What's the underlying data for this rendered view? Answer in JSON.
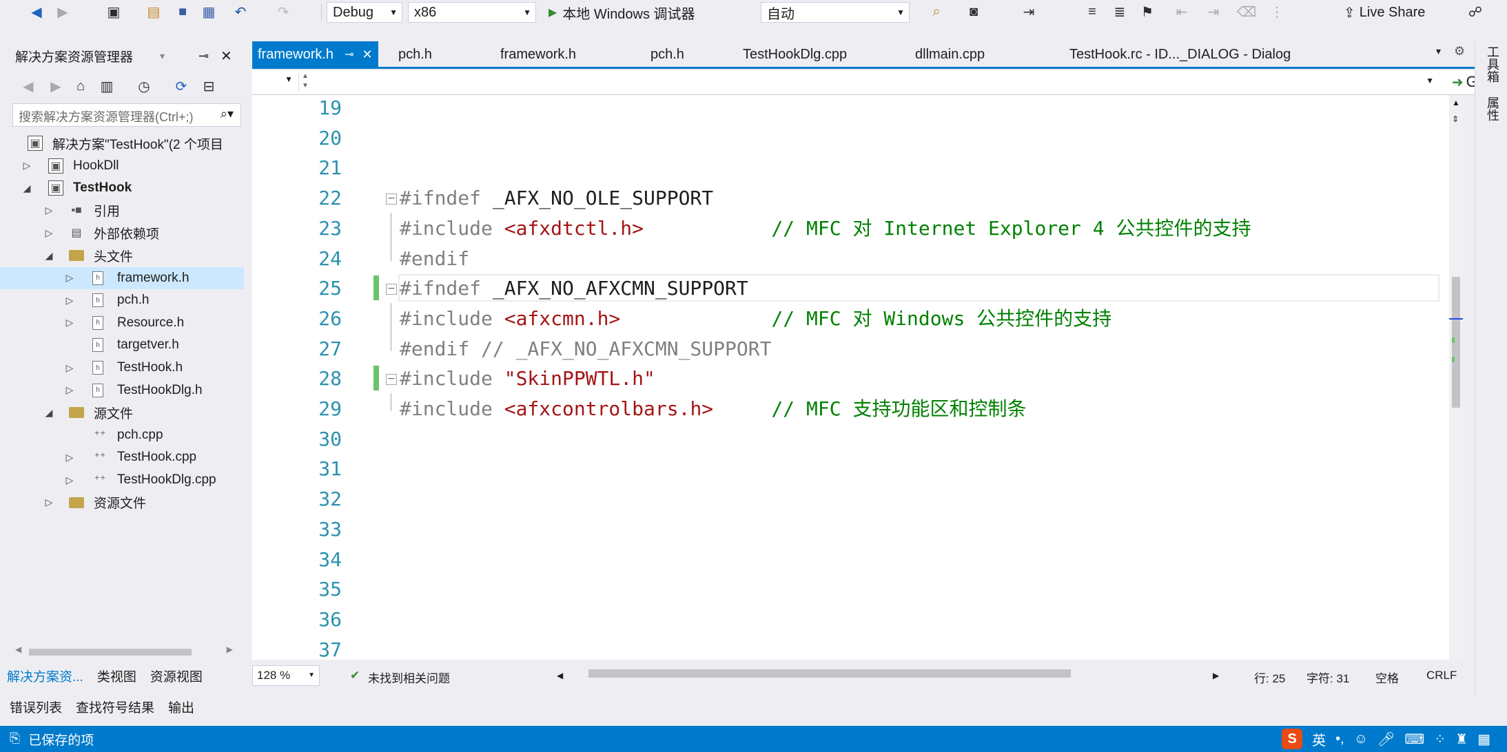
{
  "toolbar": {
    "config": "Debug",
    "platform": "x86",
    "run_label": "本地 Windows 调试器",
    "run_mode": "自动",
    "live_share": "Live Share"
  },
  "solution_explorer": {
    "title": "解决方案资源管理器",
    "search_placeholder": "搜索解决方案资源管理器(Ctrl+;)",
    "tree": [
      {
        "label": "解决方案\"TestHook\"(2 个项目",
        "depth": 0,
        "expander": "",
        "icon": "solution"
      },
      {
        "label": "HookDll",
        "depth": 0,
        "expander": "▷",
        "icon": "project"
      },
      {
        "label": "TestHook",
        "depth": 0,
        "expander": "◢",
        "icon": "project",
        "bold": true
      },
      {
        "label": "引用",
        "depth": 1,
        "expander": "▷",
        "icon": "references"
      },
      {
        "label": "外部依赖项",
        "depth": 1,
        "expander": "▷",
        "icon": "external"
      },
      {
        "label": "头文件",
        "depth": 1,
        "expander": "◢",
        "icon": "folder"
      },
      {
        "label": "framework.h",
        "depth": 2,
        "expander": "▷",
        "icon": "header",
        "selected": true
      },
      {
        "label": "pch.h",
        "depth": 2,
        "expander": "▷",
        "icon": "header"
      },
      {
        "label": "Resource.h",
        "depth": 2,
        "expander": "▷",
        "icon": "header"
      },
      {
        "label": "targetver.h",
        "depth": 2,
        "expander": "",
        "icon": "header"
      },
      {
        "label": "TestHook.h",
        "depth": 2,
        "expander": "▷",
        "icon": "header"
      },
      {
        "label": "TestHookDlg.h",
        "depth": 2,
        "expander": "▷",
        "icon": "header"
      },
      {
        "label": "源文件",
        "depth": 1,
        "expander": "◢",
        "icon": "folder"
      },
      {
        "label": "pch.cpp",
        "depth": 2,
        "expander": "",
        "icon": "cpp"
      },
      {
        "label": "TestHook.cpp",
        "depth": 2,
        "expander": "▷",
        "icon": "cpp"
      },
      {
        "label": "TestHookDlg.cpp",
        "depth": 2,
        "expander": "▷",
        "icon": "cpp"
      },
      {
        "label": "资源文件",
        "depth": 1,
        "expander": "▷",
        "icon": "folder"
      }
    ],
    "tabs": [
      "解决方案资...",
      "类视图",
      "资源视图"
    ],
    "active_tab": 0
  },
  "bottom_tabs": [
    "错误列表",
    "查找符号结果",
    "输出"
  ],
  "doc_tabs": [
    {
      "label": "framework.h",
      "active": true,
      "pin": "⊸",
      "close": "✕"
    },
    {
      "label": "pch.h"
    },
    {
      "label": "framework.h"
    },
    {
      "label": "pch.h"
    },
    {
      "label": "TestHookDlg.cpp"
    },
    {
      "label": "dllmain.cpp"
    },
    {
      "label": "TestHook.rc - ID..._DIALOG - Dialog"
    }
  ],
  "nav": {
    "go_label": "Go"
  },
  "editor": {
    "lines": [
      {
        "n": "19",
        "tokens": []
      },
      {
        "n": "20",
        "tokens": []
      },
      {
        "n": "21",
        "tokens": []
      },
      {
        "n": "22",
        "fold": "start",
        "tokens": [
          [
            "pp",
            "#ifndef "
          ],
          [
            "mac",
            "_AFX_NO_OLE_SUPPORT"
          ]
        ]
      },
      {
        "n": "23",
        "fold": "mid",
        "tokens": [
          [
            "pp",
            "#include "
          ],
          [
            "str",
            "<afxdtctl.h>"
          ],
          [
            "mac",
            "           "
          ],
          [
            "cmt",
            "// MFC 对 Internet Explorer 4 公共控件的支持"
          ]
        ]
      },
      {
        "n": "24",
        "fold": "end",
        "tokens": [
          [
            "pp",
            "#endif"
          ]
        ]
      },
      {
        "n": "25",
        "fold": "start",
        "changed": true,
        "current": true,
        "tokens": [
          [
            "pp",
            "#ifndef "
          ],
          [
            "mac",
            "_AFX_NO_AFXCMN_SUPPORT"
          ]
        ]
      },
      {
        "n": "26",
        "fold": "mid",
        "tokens": [
          [
            "pp",
            "#include "
          ],
          [
            "str",
            "<afxcmn.h>"
          ],
          [
            "mac",
            "             "
          ],
          [
            "cmt",
            "// MFC 对 Windows 公共控件的支持"
          ]
        ]
      },
      {
        "n": "27",
        "fold": "end",
        "tokens": [
          [
            "pp",
            "#endif // _AFX_NO_AFXCMN_SUPPORT"
          ]
        ]
      },
      {
        "n": "28",
        "fold": "start",
        "changed": true,
        "tokens": [
          [
            "pp",
            "#include "
          ],
          [
            "str",
            "\"SkinPPWTL.h\""
          ]
        ]
      },
      {
        "n": "29",
        "fold": "end",
        "tokens": [
          [
            "pp",
            "#include "
          ],
          [
            "str",
            "<afxcontrolbars.h>"
          ],
          [
            "mac",
            "     "
          ],
          [
            "cmt",
            "// MFC 支持功能区和控制条"
          ]
        ]
      },
      {
        "n": "30",
        "tokens": []
      },
      {
        "n": "31",
        "tokens": []
      },
      {
        "n": "32",
        "tokens": []
      },
      {
        "n": "33",
        "tokens": []
      },
      {
        "n": "34",
        "tokens": []
      },
      {
        "n": "35",
        "tokens": []
      },
      {
        "n": "36",
        "tokens": []
      },
      {
        "n": "37",
        "tokens": []
      }
    ]
  },
  "editor_footer": {
    "zoom": "128 %",
    "issues": "未找到相关问题",
    "line": "行: 25",
    "char": "字符: 31",
    "whitespace": "空格",
    "eol": "CRLF"
  },
  "right_strip": {
    "tab1": "工具箱",
    "tab2": "属性"
  },
  "status": {
    "text": "已保存的项",
    "ime_lang": "英"
  }
}
